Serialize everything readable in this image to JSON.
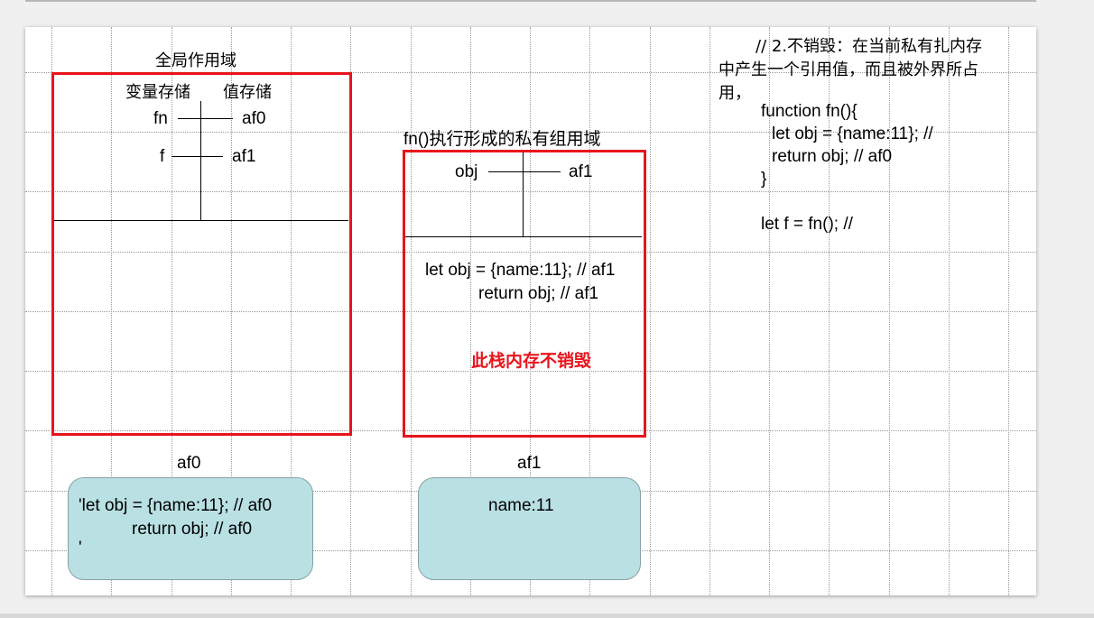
{
  "global_scope": {
    "title": "全局作用域",
    "col_var": "变量存储",
    "col_val": "值存储",
    "rows": [
      {
        "name": "fn",
        "value": "af0"
      },
      {
        "name": "f",
        "value": "af1"
      }
    ]
  },
  "private_scope": {
    "title": "fn()执行形成的私有组用域",
    "row": {
      "name": "obj",
      "value": "af1"
    },
    "code_line1": "let obj = {name:11}; // af1",
    "code_line2": "return obj; // af1",
    "note": "此栈内存不销毁",
    "note_color": "#e8141c"
  },
  "heap_af0": {
    "label": "af0",
    "line1": "'let obj = {name:11}; // af0",
    "line2": "return obj; // af0",
    "line3": "'"
  },
  "heap_af1": {
    "label": "af1",
    "content": "name:11"
  },
  "notes": {
    "line1": "// 2.不销毁：在当前私有扎内存",
    "line2": "中产生一个引用值，而且被外界所占",
    "line3": "用，",
    "code1": "function fn(){",
    "code2": "let obj = {name:11}; //",
    "code3": "return obj; // af0",
    "code4": "}",
    "code5": "let f = fn(); //"
  },
  "colors": {
    "border_red": "#e8141c",
    "heap_fill": "#b9e0e3"
  }
}
